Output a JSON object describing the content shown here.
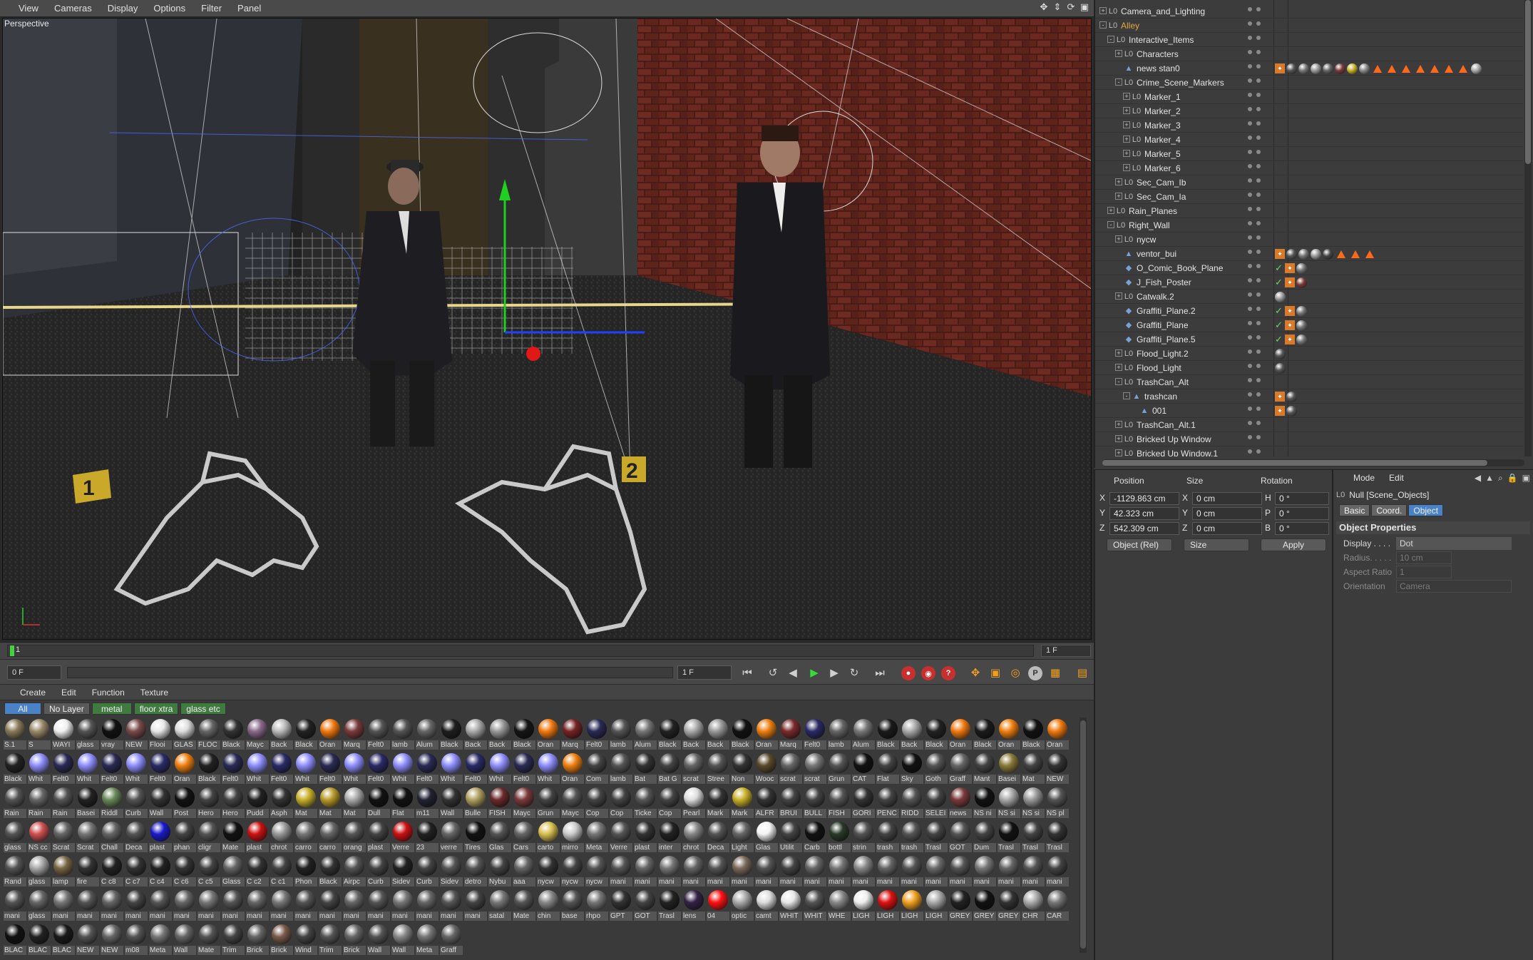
{
  "viewport": {
    "menu": [
      "View",
      "Cameras",
      "Display",
      "Options",
      "Filter",
      "Panel"
    ],
    "label": "Perspective",
    "markers": [
      "1",
      "2"
    ]
  },
  "timeline": {
    "current_frame": "1",
    "end_field": "1 F"
  },
  "transport": {
    "start_field": "0 F",
    "frame_field": "1 F"
  },
  "material_manager": {
    "menu": [
      "Create",
      "Edit",
      "Function",
      "Texture"
    ],
    "tabs": [
      "All",
      "No Layer",
      "metal",
      "floor xtra",
      "glass etc"
    ],
    "materials": [
      [
        "S.1",
        "#8a7a5a"
      ],
      [
        "S",
        "#9a8a6a"
      ],
      [
        "WAYI",
        "#f0f0f0"
      ],
      [
        "glass",
        "#555"
      ],
      [
        "vray",
        "#111"
      ],
      [
        "NEW",
        "#7a4a4a"
      ],
      [
        "Flooi",
        "#e8e8e8"
      ],
      [
        "GLAS",
        "#ddd"
      ],
      [
        "FLOC",
        "#666"
      ],
      [
        "Black",
        "#333"
      ],
      [
        "Mayc",
        "#8a6a8a"
      ],
      [
        "Back",
        "#bbb"
      ],
      [
        "Black",
        "#222"
      ],
      [
        "Oran",
        "#f07a10"
      ],
      [
        "Marq",
        "#7a3a3a"
      ],
      [
        "Felt0",
        "#555"
      ],
      [
        "lamb",
        "#555"
      ],
      [
        "Alum",
        "#666"
      ],
      [
        "Black",
        "#1e1e1e"
      ],
      [
        "Back",
        "#aaa"
      ],
      [
        "Back",
        "#999"
      ],
      [
        "Black",
        "#151515"
      ],
      [
        "Oran",
        "#f07a10"
      ],
      [
        "Marq",
        "#772222"
      ],
      [
        "Felt0",
        "#2a2a55"
      ],
      [
        "lamb",
        "#555"
      ],
      [
        "Alum",
        "#777"
      ],
      [
        "Black",
        "#222"
      ],
      [
        "Back",
        "#aaa"
      ],
      [
        "Back",
        "#999"
      ],
      [
        "Black",
        "#111"
      ],
      [
        "Oran",
        "#f08010"
      ],
      [
        "Marq",
        "#7a2a2a"
      ],
      [
        "Felt0",
        "#2a2a66"
      ],
      [
        "lamb",
        "#666"
      ],
      [
        "Alum",
        "#777"
      ],
      [
        "Black",
        "#1a1a1a"
      ],
      [
        "Back",
        "#aaa"
      ],
      [
        "Black",
        "#222"
      ],
      [
        "Oran",
        "#f07a10"
      ],
      [
        "Black",
        "#1a1a1a"
      ],
      [
        "Oran",
        "#f08010"
      ],
      [
        "Black",
        "#111"
      ],
      [
        "Oran",
        "#f07a10"
      ],
      [
        "Black",
        "#222"
      ],
      [
        "Whit",
        "#8f8fff"
      ],
      [
        "Felt0",
        "#2a2a55"
      ],
      [
        "Whit",
        "#8f8fff"
      ],
      [
        "Felt0",
        "#2a2a55"
      ],
      [
        "Whit",
        "#8f8fff"
      ],
      [
        "Felt0",
        "#2a2a66"
      ],
      [
        "Oran",
        "#f08010"
      ],
      [
        "Black",
        "#222"
      ],
      [
        "Felt0",
        "#2a2a55"
      ],
      [
        "Whit",
        "#8f8fff"
      ],
      [
        "Felt0",
        "#2a2a66"
      ],
      [
        "Whit",
        "#9090ff"
      ],
      [
        "Felt0",
        "#2a2a55"
      ],
      [
        "Whit",
        "#8f8fff"
      ],
      [
        "Felt0",
        "#2a2a66"
      ],
      [
        "Whit",
        "#8f8fff"
      ],
      [
        "Felt0",
        "#2a2a55"
      ],
      [
        "Whit",
        "#8f8fff"
      ],
      [
        "Felt0",
        "#2a2a66"
      ],
      [
        "Whit",
        "#9090ff"
      ],
      [
        "Felt0",
        "#2a2a55"
      ],
      [
        "Whit",
        "#8f8fff"
      ],
      [
        "Oran",
        "#f08010"
      ],
      [
        "Com",
        "#444"
      ],
      [
        "lamb",
        "#555"
      ],
      [
        "Bat",
        "#333"
      ],
      [
        "Bat G",
        "#444"
      ],
      [
        "scrat",
        "#666"
      ],
      [
        "Stree",
        "#555"
      ],
      [
        "Non",
        "#333"
      ],
      [
        "Wooc",
        "#5a4a2a"
      ],
      [
        "scrat",
        "#666"
      ],
      [
        "scrat",
        "#777"
      ],
      [
        "Grun",
        "#555"
      ],
      [
        "CAT",
        "#111"
      ],
      [
        "Flat",
        "#444"
      ],
      [
        "Sky",
        "#111"
      ],
      [
        "Goth",
        "#555"
      ],
      [
        "Graff",
        "#666"
      ],
      [
        "Mant",
        "#444"
      ],
      [
        "Basei",
        "#8a7a3a"
      ],
      [
        "Mat",
        "#444"
      ],
      [
        "NEW",
        "#333"
      ],
      [
        "Rain",
        "#555"
      ],
      [
        "Rain",
        "#666"
      ],
      [
        "Rain",
        "#555"
      ],
      [
        "Basei",
        "#222"
      ],
      [
        "Riddl",
        "#6a8a5a"
      ],
      [
        "Curb",
        "#555"
      ],
      [
        "Wall",
        "#333"
      ],
      [
        "Post",
        "#111"
      ],
      [
        "Hero",
        "#444"
      ],
      [
        "Hero",
        "#444"
      ],
      [
        "Pudd",
        "#222"
      ],
      [
        "Asph",
        "#333"
      ],
      [
        "Mat",
        "#c9b02a"
      ],
      [
        "Mat",
        "#b89a2a"
      ],
      [
        "Mat",
        "#aaa"
      ],
      [
        "Dull",
        "#111"
      ],
      [
        "Flat",
        "#111"
      ],
      [
        "m11",
        "#223"
      ],
      [
        "Wall",
        "#333"
      ],
      [
        "Bulle",
        "#b0a060"
      ],
      [
        "FISH",
        "#6a2a2a"
      ],
      [
        "Mayc",
        "#7a3a3a"
      ],
      [
        "Grun",
        "#444"
      ],
      [
        "Mayc",
        "#555"
      ],
      [
        "Cop",
        "#444"
      ],
      [
        "Cop",
        "#444"
      ],
      [
        "Ticke",
        "#555"
      ],
      [
        "Cop",
        "#444"
      ],
      [
        "Pearl",
        "#ddd"
      ],
      [
        "Mark",
        "#333"
      ],
      [
        "Mark",
        "#c9b02a"
      ],
      [
        "ALFR",
        "#333"
      ],
      [
        "BRUI",
        "#444"
      ],
      [
        "BULL",
        "#444"
      ],
      [
        "FISH",
        "#555"
      ],
      [
        "GORI",
        "#333"
      ],
      [
        "PENC",
        "#444"
      ],
      [
        "RIDD",
        "#555"
      ],
      [
        "SELEI",
        "#444"
      ],
      [
        "news",
        "#7a3a3a"
      ],
      [
        "NS ni",
        "#111"
      ],
      [
        "NS si",
        "#aaa"
      ],
      [
        "NS si",
        "#999"
      ],
      [
        "NS pl",
        "#555"
      ],
      [
        "glass",
        "#555"
      ],
      [
        "NS cc",
        "#d05050"
      ],
      [
        "Scrat",
        "#666"
      ],
      [
        "Scrat",
        "#777"
      ],
      [
        "Chall",
        "#666"
      ],
      [
        "Deca",
        "#555"
      ],
      [
        "plast",
        "#1a1acc"
      ],
      [
        "phan",
        "#444"
      ],
      [
        "cligr",
        "#555"
      ],
      [
        "Mate",
        "#111"
      ],
      [
        "plast",
        "#cc1111"
      ],
      [
        "chrot",
        "#999"
      ],
      [
        "carro",
        "#777"
      ],
      [
        "carro",
        "#666"
      ],
      [
        "orang",
        "#555"
      ],
      [
        "plast",
        "#444"
      ],
      [
        "Verre",
        "#cc1111"
      ],
      [
        "23",
        "#222"
      ],
      [
        "verre",
        "#666"
      ],
      [
        "Tires",
        "#111"
      ],
      [
        "Glas",
        "#555"
      ],
      [
        "Cars",
        "#666"
      ],
      [
        "carto",
        "#d8c050"
      ],
      [
        "mirro",
        "#ccc"
      ],
      [
        "Meta",
        "#777"
      ],
      [
        "Verre",
        "#555"
      ],
      [
        "plast",
        "#333"
      ],
      [
        "inter",
        "#222"
      ],
      [
        "chrot",
        "#888"
      ],
      [
        "Deca",
        "#555"
      ],
      [
        "Light",
        "#666"
      ],
      [
        "Glas",
        "#f4f4f4"
      ],
      [
        "Utilit",
        "#444"
      ],
      [
        "Carb",
        "#111"
      ],
      [
        "bottl",
        "#2a3a2a"
      ],
      [
        "strin",
        "#555"
      ],
      [
        "trash",
        "#444"
      ],
      [
        "trash",
        "#555"
      ],
      [
        "Trasl",
        "#444"
      ],
      [
        "GOT",
        "#555"
      ],
      [
        "Dum",
        "#444"
      ],
      [
        "Trasl",
        "#111"
      ],
      [
        "Trasl",
        "#444"
      ],
      [
        "Trasl",
        "#333"
      ],
      [
        "Rand",
        "#555"
      ],
      [
        "glass",
        "#aaa"
      ],
      [
        "lamp",
        "#776644"
      ],
      [
        "fire",
        "#333"
      ],
      [
        "C c8",
        "#222"
      ],
      [
        "C c7",
        "#333"
      ],
      [
        "C c4",
        "#222"
      ],
      [
        "C c6",
        "#333"
      ],
      [
        "C c5",
        "#444"
      ],
      [
        "Glass",
        "#666"
      ],
      [
        "C c2",
        "#333"
      ],
      [
        "C c1",
        "#444"
      ],
      [
        "Phon",
        "#222"
      ],
      [
        "Black",
        "#333"
      ],
      [
        "Airpc",
        "#555"
      ],
      [
        "Curb",
        "#444"
      ],
      [
        "Sidev",
        "#222"
      ],
      [
        "Curb",
        "#444"
      ],
      [
        "Sidev",
        "#555"
      ],
      [
        "detro",
        "#555"
      ],
      [
        "Nybu",
        "#444"
      ],
      [
        "aaa",
        "#666"
      ],
      [
        "nycw",
        "#333"
      ],
      [
        "nycw",
        "#444"
      ],
      [
        "nycw",
        "#555"
      ],
      [
        "mani",
        "#555"
      ],
      [
        "mani",
        "#666"
      ],
      [
        "mani",
        "#777"
      ],
      [
        "mani",
        "#666"
      ],
      [
        "mani",
        "#555"
      ],
      [
        "mani",
        "#7a6a5a"
      ],
      [
        "mani",
        "#555"
      ],
      [
        "mani",
        "#444"
      ],
      [
        "mani",
        "#666"
      ],
      [
        "mani",
        "#777"
      ],
      [
        "mani",
        "#888"
      ],
      [
        "mani",
        "#666"
      ],
      [
        "mani",
        "#555"
      ],
      [
        "mani",
        "#6a6a6a"
      ],
      [
        "mani",
        "#555"
      ],
      [
        "mani",
        "#777"
      ],
      [
        "mani",
        "#666"
      ],
      [
        "mani",
        "#555"
      ],
      [
        "mani",
        "#444"
      ],
      [
        "mani",
        "#555"
      ],
      [
        "glass",
        "#666"
      ],
      [
        "mani",
        "#777"
      ],
      [
        "mani",
        "#555"
      ],
      [
        "mani",
        "#666"
      ],
      [
        "mani",
        "#444"
      ],
      [
        "mani",
        "#555"
      ],
      [
        "mani",
        "#666"
      ],
      [
        "mani",
        "#777"
      ],
      [
        "mani",
        "#555"
      ],
      [
        "mani",
        "#666"
      ],
      [
        "mani",
        "#777"
      ],
      [
        "mani",
        "#555"
      ],
      [
        "mani",
        "#444"
      ],
      [
        "mani",
        "#666"
      ],
      [
        "mani",
        "#555"
      ],
      [
        "mani",
        "#777"
      ],
      [
        "mani",
        "#666"
      ],
      [
        "mani",
        "#555"
      ],
      [
        "mani",
        "#444"
      ],
      [
        "satal",
        "#777"
      ],
      [
        "Mate",
        "#555"
      ],
      [
        "chin",
        "#888"
      ],
      [
        "base",
        "#555"
      ],
      [
        "rhpo",
        "#777"
      ],
      [
        "GPT",
        "#333"
      ],
      [
        "GOT",
        "#444"
      ],
      [
        "Trasl",
        "#222"
      ],
      [
        "lens",
        "#332244"
      ],
      [
        "04",
        "#ff1111"
      ],
      [
        "optic",
        "#aaa"
      ],
      [
        "camt",
        "#ddd"
      ],
      [
        "WHIT",
        "#e8e8e8"
      ],
      [
        "WHIT",
        "#555"
      ],
      [
        "WHE",
        "#888"
      ],
      [
        "LIGH",
        "#eee"
      ],
      [
        "LIGH",
        "#dd1111"
      ],
      [
        "LIGH",
        "#f0a020"
      ],
      [
        "LIGH",
        "#aaa"
      ],
      [
        "GREY",
        "#222"
      ],
      [
        "GREY",
        "#111"
      ],
      [
        "GREY",
        "#333"
      ],
      [
        "",
        ""
      ],
      [
        "",
        ""
      ],
      [
        "CHR",
        "#aaa"
      ],
      [
        "CAR",
        "#777"
      ],
      [
        "BLAC",
        "#111"
      ],
      [
        "BLAC",
        "#222"
      ],
      [
        "BLAC",
        "#1a1a1a"
      ],
      [
        "NEW",
        "#555"
      ],
      [
        "NEW",
        "#666"
      ],
      [
        "m08",
        "#555"
      ],
      [
        "Meta",
        "#777"
      ],
      [
        "Wall",
        "#666"
      ],
      [
        "Mate",
        "#555"
      ],
      [
        "Trim",
        "#444"
      ],
      [
        "Brick",
        "#666"
      ],
      [
        "Brick",
        "#7a5a4a"
      ],
      [
        "Wind",
        "#444"
      ],
      [
        "Trim",
        "#555"
      ],
      [
        "Brick",
        "#666"
      ],
      [
        "Wall",
        "#555"
      ],
      [
        "Wall",
        "#888"
      ],
      [
        "Meta",
        "#777"
      ],
      [
        "Graff",
        "#666"
      ]
    ]
  },
  "object_manager": {
    "rows": [
      {
        "name": "Camera_and_Lighting",
        "depth": 0,
        "icon": "null",
        "exp": "+"
      },
      {
        "name": "Alley",
        "depth": 0,
        "icon": "null",
        "exp": "-",
        "orange": true
      },
      {
        "name": "Interactive_Items",
        "depth": 1,
        "icon": "null",
        "exp": "-"
      },
      {
        "name": "Characters",
        "depth": 2,
        "icon": "null",
        "exp": "+"
      },
      {
        "name": "news stan0",
        "depth": 2,
        "icon": "poly",
        "exp": ""
      },
      {
        "name": "Crime_Scene_Markers",
        "depth": 2,
        "icon": "null",
        "exp": "-"
      },
      {
        "name": "Marker_1",
        "depth": 3,
        "icon": "null",
        "exp": "+"
      },
      {
        "name": "Marker_2",
        "depth": 3,
        "icon": "null",
        "exp": "+"
      },
      {
        "name": "Marker_3",
        "depth": 3,
        "icon": "null",
        "exp": "+"
      },
      {
        "name": "Marker_4",
        "depth": 3,
        "icon": "null",
        "exp": "+"
      },
      {
        "name": "Marker_5",
        "depth": 3,
        "icon": "null",
        "exp": "+"
      },
      {
        "name": "Marker_6",
        "depth": 3,
        "icon": "null",
        "exp": "+"
      },
      {
        "name": "Sec_Cam_Ib",
        "depth": 2,
        "icon": "null",
        "exp": "+"
      },
      {
        "name": "Sec_Cam_Ia",
        "depth": 2,
        "icon": "null",
        "exp": "+"
      },
      {
        "name": "Rain_Planes",
        "depth": 1,
        "icon": "null",
        "exp": "+"
      },
      {
        "name": "Right_Wall",
        "depth": 1,
        "icon": "null",
        "exp": "-"
      },
      {
        "name": "nycw",
        "depth": 2,
        "icon": "null",
        "exp": "+"
      },
      {
        "name": "ventor_bui",
        "depth": 2,
        "icon": "poly",
        "exp": ""
      },
      {
        "name": "O_Comic_Book_Plane",
        "depth": 2,
        "icon": "plane",
        "exp": ""
      },
      {
        "name": "J_Fish_Poster",
        "depth": 2,
        "icon": "plane",
        "exp": ""
      },
      {
        "name": "Catwalk.2",
        "depth": 2,
        "icon": "null",
        "exp": "+"
      },
      {
        "name": "Graffiti_Plane.2",
        "depth": 2,
        "icon": "plane",
        "exp": ""
      },
      {
        "name": "Graffiti_Plane",
        "depth": 2,
        "icon": "plane",
        "exp": ""
      },
      {
        "name": "Graffiti_Plane.5",
        "depth": 2,
        "icon": "plane",
        "exp": ""
      },
      {
        "name": "Flood_Light.2",
        "depth": 2,
        "icon": "null",
        "exp": "+"
      },
      {
        "name": "Flood_Light",
        "depth": 2,
        "icon": "null",
        "exp": "+"
      },
      {
        "name": "TrashCan_Alt",
        "depth": 2,
        "icon": "null",
        "exp": "-"
      },
      {
        "name": "trashcan",
        "depth": 3,
        "icon": "poly",
        "exp": "-"
      },
      {
        "name": "001",
        "depth": 4,
        "icon": "poly",
        "exp": ""
      },
      {
        "name": "TrashCan_Alt.1",
        "depth": 2,
        "icon": "null",
        "exp": "+"
      },
      {
        "name": "Bricked Up Window",
        "depth": 2,
        "icon": "null",
        "exp": "+"
      },
      {
        "name": "Bricked Up Window.1",
        "depth": 2,
        "icon": "null",
        "exp": "+"
      }
    ]
  },
  "coordinates": {
    "headers": [
      "Position",
      "Size",
      "Rotation"
    ],
    "rows": [
      {
        "axis": "X",
        "pos": "-1129.863 cm",
        "size_axis": "X",
        "size": "0 cm",
        "rot_axis": "H",
        "rot": "0 °"
      },
      {
        "axis": "Y",
        "pos": "42.323 cm",
        "size_axis": "Y",
        "size": "0 cm",
        "rot_axis": "P",
        "rot": "0 °"
      },
      {
        "axis": "Z",
        "pos": "542.309 cm",
        "size_axis": "Z",
        "size": "0 cm",
        "rot_axis": "B",
        "rot": "0 °"
      }
    ],
    "mode_dropdown": "Object (Rel)",
    "size_dropdown": "Size",
    "apply_label": "Apply"
  },
  "attributes": {
    "menu": [
      "Mode",
      "Edit"
    ],
    "title": "Null [Scene_Objects]",
    "tabs": [
      "Basic",
      "Coord.",
      "Object"
    ],
    "section": "Object Properties",
    "display_label": "Display . . . .",
    "display_value": "Dot",
    "radius_label": "Radius. . . . .",
    "radius_value": "10 cm",
    "aspect_label": "Aspect Ratio",
    "aspect_value": "1",
    "orientation_label": "Orientation",
    "orientation_value": "Camera"
  }
}
